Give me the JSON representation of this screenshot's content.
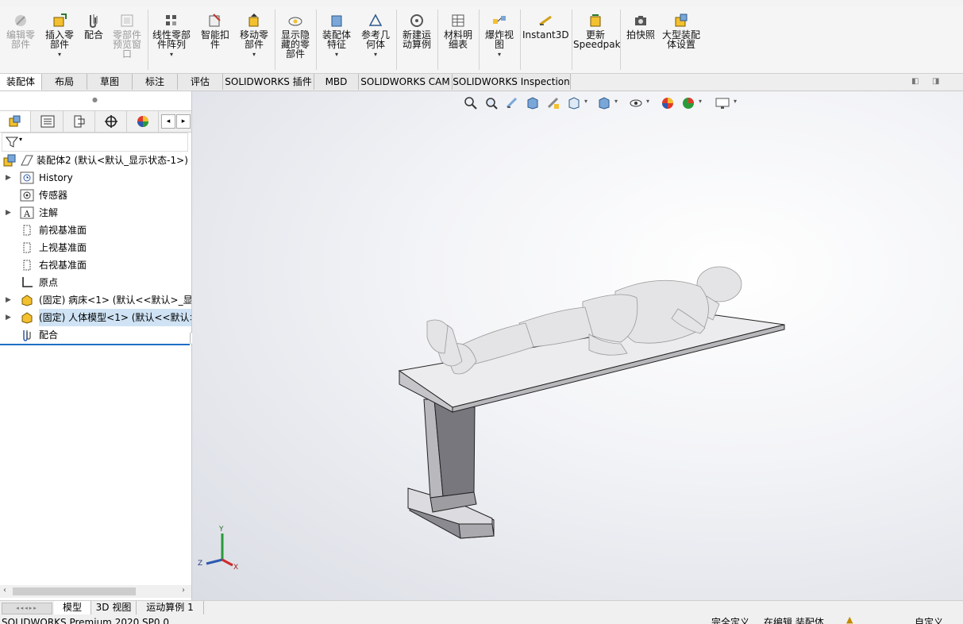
{
  "ribbon": {
    "buttons": [
      {
        "label": "编辑零部件",
        "icon": "edit-component-icon",
        "disabled": true
      },
      {
        "label": "插入零部件",
        "icon": "insert-component-icon"
      },
      {
        "label": "配合",
        "icon": "mate-icon"
      },
      {
        "label": "零部件预览窗口",
        "icon": "component-preview-icon",
        "disabled": true
      },
      {
        "label": "线性零部件阵列",
        "icon": "linear-pattern-icon"
      },
      {
        "label": "智能扣件",
        "icon": "smart-fastener-icon"
      },
      {
        "label": "移动零部件",
        "icon": "move-component-icon"
      },
      {
        "label": "显示隐藏的零部件",
        "icon": "show-hidden-icon"
      },
      {
        "label": "装配体特征",
        "icon": "assembly-feature-icon"
      },
      {
        "label": "参考几何体",
        "icon": "reference-geometry-icon"
      },
      {
        "label": "新建运动算例",
        "icon": "new-motion-study-icon"
      },
      {
        "label": "材料明细表",
        "icon": "bom-icon"
      },
      {
        "label": "爆炸视图",
        "icon": "exploded-view-icon"
      },
      {
        "label": "Instant3D",
        "icon": "instant3d-icon"
      },
      {
        "label": "更新Speedpak",
        "icon": "speedpak-icon"
      },
      {
        "label": "拍快照",
        "icon": "snapshot-icon"
      },
      {
        "label": "大型装配体设置",
        "icon": "large-assembly-icon"
      }
    ]
  },
  "tabs": [
    "装配体",
    "布局",
    "草图",
    "标注",
    "评估",
    "SOLIDWORKS 插件",
    "MBD",
    "SOLIDWORKS CAM",
    "SOLIDWORKS Inspection"
  ],
  "tree": {
    "root": "装配体2  (默认<默认_显示状态-1>)",
    "items": [
      {
        "label": "History",
        "icon": "history-icon",
        "expandable": true
      },
      {
        "label": "传感器",
        "icon": "sensor-icon",
        "expandable": false
      },
      {
        "label": "注解",
        "icon": "annotation-icon",
        "expandable": true
      },
      {
        "label": "前视基准面",
        "icon": "plane-icon",
        "expandable": false
      },
      {
        "label": "上视基准面",
        "icon": "plane-icon",
        "expandable": false
      },
      {
        "label": "右视基准面",
        "icon": "plane-icon",
        "expandable": false
      },
      {
        "label": "原点",
        "icon": "origin-icon",
        "expandable": false
      },
      {
        "label": "(固定) 病床<1> (默认<<默认>_显示",
        "icon": "part-icon",
        "expandable": true
      },
      {
        "label": "(固定) 人体模型<1> (默认<<默认>",
        "icon": "part-icon",
        "expandable": true,
        "selected": true
      },
      {
        "label": "配合",
        "icon": "mates-folder-icon",
        "expandable": false
      }
    ]
  },
  "bottom_tabs": [
    "模型",
    "3D 视图",
    "运动算例 1"
  ],
  "status": {
    "left": "SOLIDWORKS Premium 2020 SP0.0",
    "state": "完全定义",
    "editing": "在编辑 装配体",
    "units": "自定义"
  },
  "triad": {
    "x": "X",
    "y": "Y",
    "z": "Z"
  },
  "colors": {
    "accent": "#1f6fc5",
    "selection": "#cfe3f5",
    "part": "#e6e6e6"
  }
}
